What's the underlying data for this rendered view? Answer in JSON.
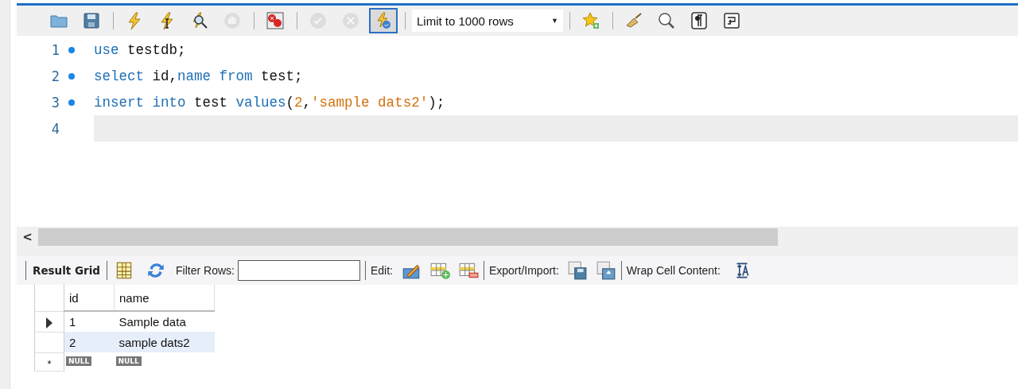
{
  "toolbar": {
    "buttons": [
      {
        "kind": "folder",
        "pressed": false,
        "disabled": false
      },
      {
        "kind": "save",
        "pressed": false,
        "disabled": false
      },
      {
        "kind": "sep"
      },
      {
        "kind": "bolt",
        "pressed": false,
        "disabled": false
      },
      {
        "kind": "bolt-cursor",
        "pressed": false,
        "disabled": false
      },
      {
        "kind": "bolt-magnifier",
        "pressed": false,
        "disabled": false
      },
      {
        "kind": "hand",
        "pressed": false,
        "disabled": true
      },
      {
        "kind": "sep"
      },
      {
        "kind": "error-stop",
        "pressed": false,
        "disabled": false
      },
      {
        "kind": "sep"
      },
      {
        "kind": "check",
        "pressed": false,
        "disabled": true
      },
      {
        "kind": "cross",
        "pressed": false,
        "disabled": true
      },
      {
        "kind": "autocommit",
        "pressed": true,
        "disabled": false
      },
      {
        "kind": "sep"
      },
      {
        "kind": "select",
        "value": "Limit to 1000 rows",
        "caret": "▼"
      },
      {
        "kind": "sep"
      },
      {
        "kind": "star-plus",
        "pressed": false,
        "disabled": false
      },
      {
        "kind": "sep"
      },
      {
        "kind": "broom",
        "pressed": false,
        "disabled": false
      },
      {
        "kind": "find",
        "pressed": false,
        "disabled": false
      },
      {
        "kind": "pilcrow",
        "pressed": false,
        "disabled": false
      },
      {
        "kind": "wrap",
        "pressed": false,
        "disabled": false
      }
    ]
  },
  "editor": {
    "lines": [
      {
        "number": "1",
        "statement": true,
        "current": false,
        "tokens": [
          {
            "kind": "keyword",
            "text": "use"
          },
          {
            "kind": "plain",
            "text": " testdb;"
          }
        ]
      },
      {
        "number": "2",
        "statement": true,
        "current": false,
        "tokens": [
          {
            "kind": "keyword",
            "text": "select"
          },
          {
            "kind": "plain",
            "text": " id,"
          },
          {
            "kind": "keyword",
            "text": "name from"
          },
          {
            "kind": "plain",
            "text": " test;"
          }
        ]
      },
      {
        "number": "3",
        "statement": true,
        "current": false,
        "tokens": [
          {
            "kind": "keyword",
            "text": "insert into"
          },
          {
            "kind": "plain",
            "text": " test "
          },
          {
            "kind": "keyword",
            "text": "values"
          },
          {
            "kind": "plain",
            "text": "("
          },
          {
            "kind": "literal",
            "text": "2"
          },
          {
            "kind": "plain",
            "text": ","
          },
          {
            "kind": "literal",
            "text": "'sample dats2'"
          },
          {
            "kind": "plain",
            "text": ");"
          }
        ]
      },
      {
        "number": "4",
        "statement": false,
        "current": true
      }
    ],
    "scroll_left": "<"
  },
  "result_toolbar": {
    "tab": "Result Grid",
    "filter_label": "Filter Rows:",
    "edit_label": "Edit:",
    "export_label": "Export/Import:",
    "wrap_label": "Wrap Cell Content:"
  },
  "grid": {
    "columns": [
      "id",
      "name"
    ],
    "rows": [
      {
        "cells": [
          "1",
          "Sample data"
        ],
        "current": true,
        "selected": false
      },
      {
        "cells": [
          "2",
          "sample dats2"
        ],
        "current": false,
        "selected": true
      }
    ],
    "new_row": {
      "marker": "*",
      "cells": [
        "NULL",
        "NULL"
      ]
    }
  }
}
